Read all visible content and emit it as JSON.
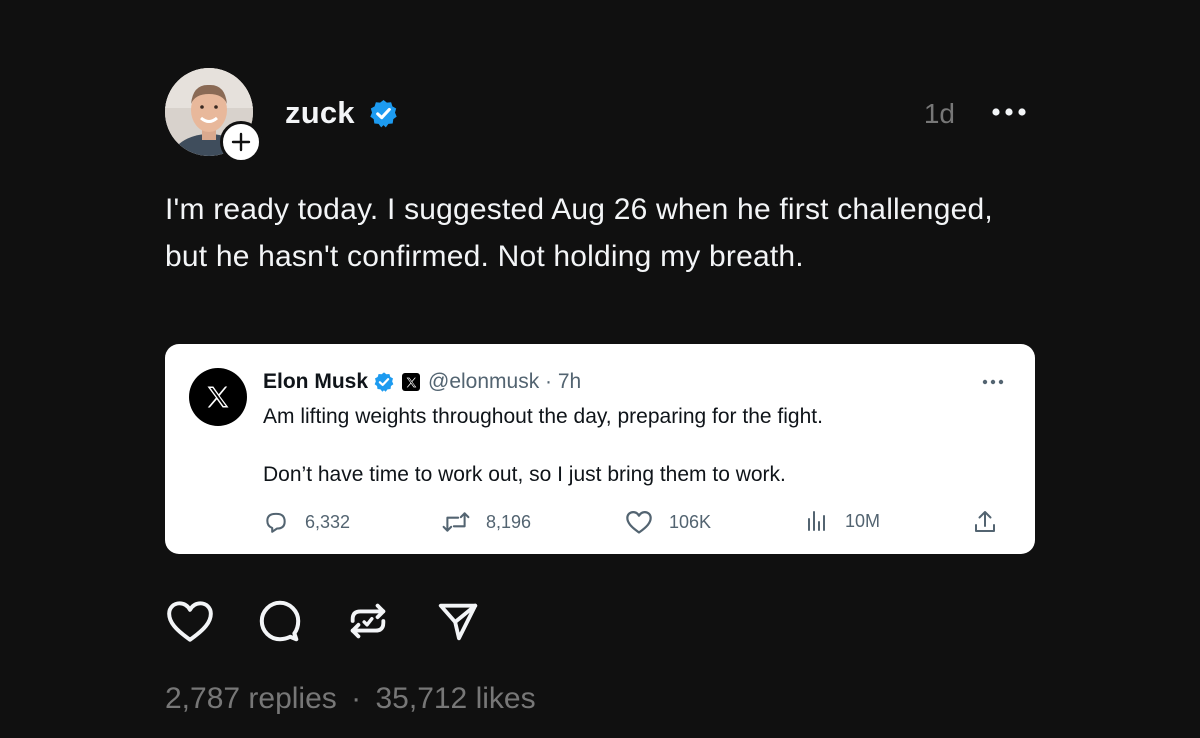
{
  "post": {
    "username": "zuck",
    "timestamp": "1d",
    "text": "I'm ready today. I suggested Aug 26 when he first challenged, but he hasn't confirmed. Not holding my breath.",
    "replies": "2,787 replies",
    "separator": "·",
    "likes": "35,712 likes"
  },
  "embed": {
    "name": "Elon Musk",
    "handle": "@elonmusk · 7h",
    "line1": "Am lifting weights throughout the day, preparing for the fight.",
    "line2": "Don’t have time to work out, so I just bring them to work.",
    "stats": {
      "replies": "6,332",
      "reposts": "8,196",
      "likes": "106K",
      "views": "10M"
    }
  },
  "colors": {
    "background": "#101010",
    "text_primary": "#f3f5f7",
    "text_secondary": "#777777",
    "verified_blue": "#1d9bf0",
    "embed_bg": "#ffffff"
  },
  "icons": {
    "verified": "verified-badge-icon",
    "follow": "plus-icon",
    "more": "more-horizontal-icon",
    "like": "heart-icon",
    "reply": "comment-icon",
    "repost": "repost-icon",
    "share": "send-icon",
    "x_logo": "x-logo-icon",
    "views": "bar-chart-icon",
    "upload": "share-upload-icon"
  }
}
